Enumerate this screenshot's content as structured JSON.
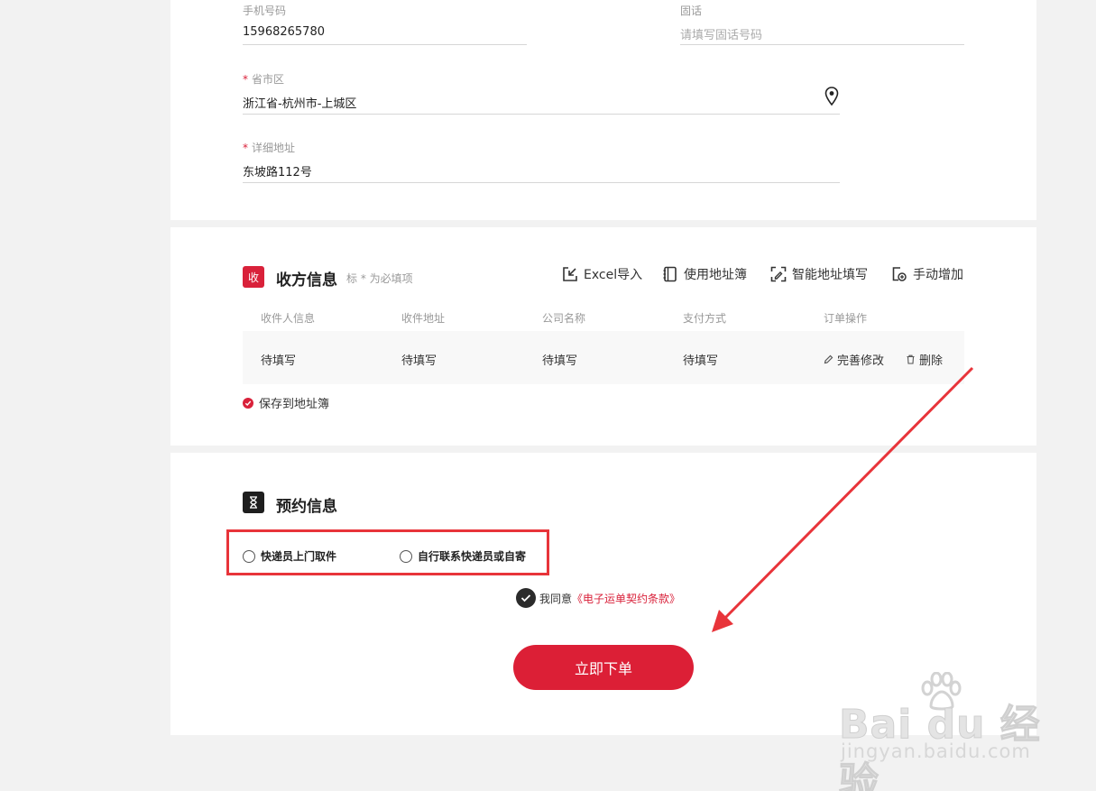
{
  "sender": {
    "phone_label": "手机号码",
    "phone_value": "15968265780",
    "tel_label": "固话",
    "tel_placeholder": "请填写固话号码",
    "region_req": "*",
    "region_label": "省市区",
    "region_value": "浙江省-杭州市-上城区",
    "detail_req": "*",
    "detail_label": "详细地址",
    "detail_value": "东坡路112号"
  },
  "receiver": {
    "badge": "收",
    "title": "收方信息",
    "hint": "标 * 为必填项",
    "tools": [
      "Excel导入",
      "使用地址簿",
      "智能地址填写",
      "手动增加"
    ],
    "columns": [
      "收件人信息",
      "收件地址",
      "公司名称",
      "支付方式",
      "订单操作"
    ],
    "row": [
      "待填写",
      "待填写",
      "待填写",
      "待填写"
    ],
    "ops": [
      "完善修改",
      "删除"
    ],
    "save_label": "保存到地址簿"
  },
  "appointment": {
    "title": "预约信息",
    "options": [
      "快递员上门取件",
      "自行联系快递员或自寄"
    ],
    "agree_text": "我同意",
    "agree_link": "《电子运单契约条款》",
    "submit_label": "立即下单"
  },
  "watermark": {
    "brand": "Bai du 经验",
    "url": "jingyan.baidu.com"
  },
  "colors": {
    "accent": "#dc1f36",
    "annotation": "#e8343a"
  }
}
